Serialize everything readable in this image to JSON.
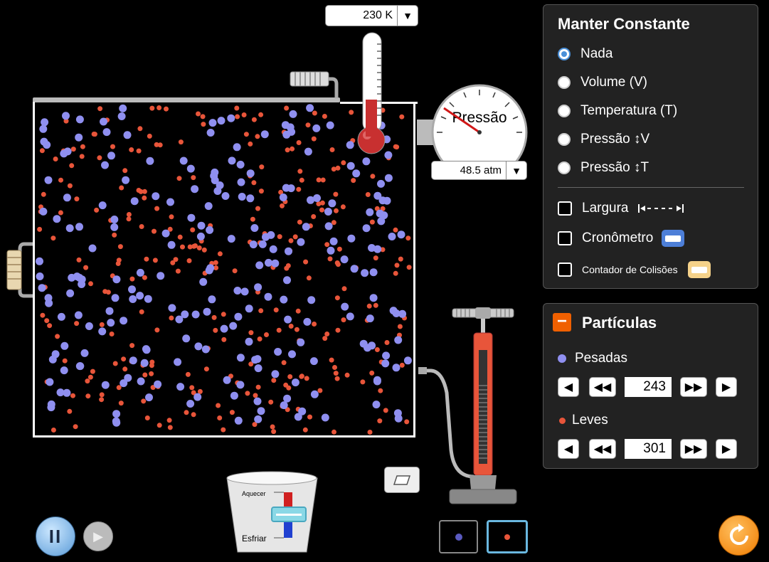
{
  "thermometer": {
    "value": "230 K",
    "dropdown": "▼",
    "level": 0.35
  },
  "gauge": {
    "label": "Pressão",
    "value": "48.5 atm",
    "dropdown": "▼"
  },
  "constant_panel": {
    "title": "Manter Constante",
    "options": [
      "Nada",
      "Volume (V)",
      "Temperatura (T)",
      "Pressão ↕V",
      "Pressão ↕T"
    ],
    "selected": "Nada",
    "checkboxes": {
      "width": "Largura",
      "timer": "Cronômetro",
      "collisions": "Contador de Colisões"
    }
  },
  "particles_panel": {
    "collapse_symbol": "−",
    "title": "Partículas",
    "heavy": {
      "label": "Pesadas",
      "count": "243",
      "color": "#8f8ff0"
    },
    "light": {
      "label": "Leves",
      "count": "301",
      "color": "#e8553a"
    }
  },
  "heater": {
    "heat_label": "Aquecer",
    "cool_label": "Esfriar"
  },
  "controls": {
    "pause_symbol": "II",
    "step_symbol": "▶"
  },
  "colors": {
    "accent": "#f07c00",
    "heavy": "#8f8ff0",
    "light": "#e8553a"
  }
}
